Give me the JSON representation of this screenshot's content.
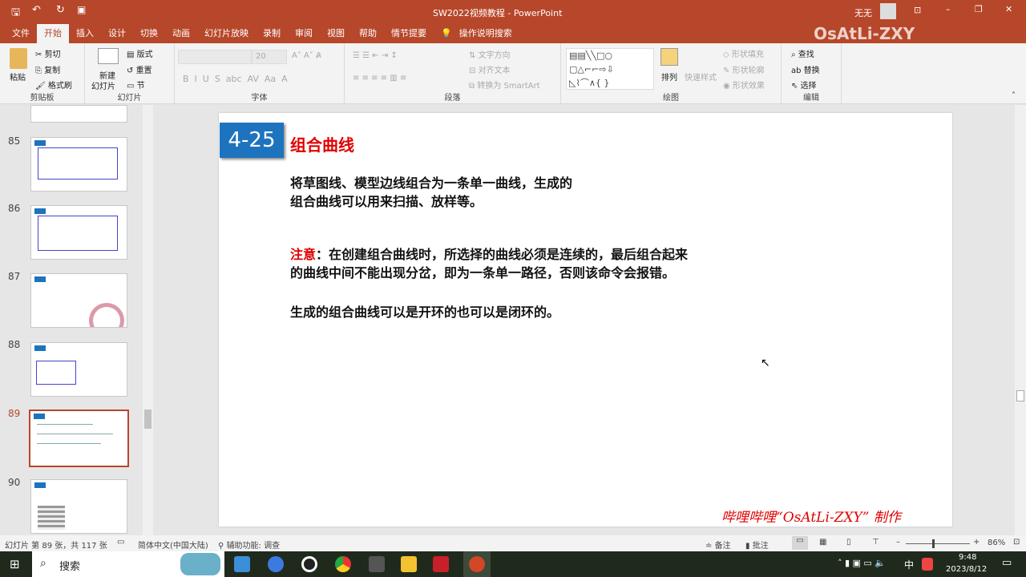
{
  "window": {
    "title": "SW2022视频教程 - PowerPoint",
    "user": "无无",
    "watermark": "OsAtLi-ZXY"
  },
  "tabs": [
    "文件",
    "开始",
    "插入",
    "设计",
    "切换",
    "动画",
    "幻灯片放映",
    "录制",
    "审阅",
    "视图",
    "帮助",
    "情节提要"
  ],
  "active_tab": "开始",
  "search_label": "操作说明搜索",
  "ribbon": {
    "clipboard": {
      "paste": "粘贴",
      "cut": "剪切",
      "copy": "复制",
      "format_painter": "格式刷",
      "label": "剪贴板"
    },
    "slides": {
      "new_slide_1": "新建",
      "new_slide_2": "幻灯片",
      "layout": "版式",
      "reset": "重置",
      "section": "节",
      "label": "幻灯片"
    },
    "font": {
      "size": "20",
      "label": "字体"
    },
    "paragraph": {
      "text_direction": "文字方向",
      "align_text": "对齐文本",
      "smartart": "转换为 SmartArt",
      "label": "段落"
    },
    "drawing": {
      "arrange": "排列",
      "quick_styles": "快速样式",
      "shape_fill": "形状填充",
      "shape_outline": "形状轮廓",
      "shape_effects": "形状效果",
      "label": "绘图"
    },
    "editing": {
      "find": "查找",
      "replace": "替换",
      "select": "选择",
      "label": "编辑"
    }
  },
  "thumbnails": [
    {
      "num": "85"
    },
    {
      "num": "86"
    },
    {
      "num": "87"
    },
    {
      "num": "88"
    },
    {
      "num": "89",
      "selected": true
    },
    {
      "num": "90"
    }
  ],
  "slide": {
    "badge": "4-25",
    "title": "组合曲线",
    "para1_line1": "将草图线、模型边线组合为一条单一曲线，生成的",
    "para1_line2": "组合曲线可以用来扫描、放样等。",
    "note_label": "注意",
    "note_line1": "：在创建组合曲线时，所选择的曲线必须是连续的，最后组合起来",
    "note_line2": "的曲线中间不能出现分岔，即为一条单一路径，否则该命令会报错。",
    "para3": "生成的组合曲线可以是开环的也可以是闭环的。",
    "footer": "哔哩哔哩“OsAtLi-ZXY” 制作"
  },
  "status": {
    "slide_info": "幻灯片 第 89 张，共 117 张",
    "language": "简体中文(中国大陆)",
    "accessibility": "辅助功能: 调查",
    "notes": "备注",
    "comments": "批注",
    "zoom": "86%"
  },
  "taskbar": {
    "search": "搜索",
    "time": "9:48",
    "date": "2023/8/12",
    "ime": "中"
  },
  "colors": {
    "accent": "#b7472a",
    "badge": "#1e73be",
    "red": "#e00000"
  }
}
